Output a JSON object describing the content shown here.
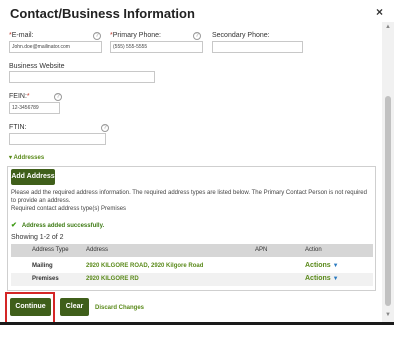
{
  "dialog": {
    "title": "Contact/Business Information",
    "close_glyph": "×"
  },
  "form": {
    "email": {
      "label": "E-mail:",
      "value": "John.doe@mailinator.com"
    },
    "primary_phone": {
      "label": "Primary Phone:",
      "value": "(555) 555-5555"
    },
    "secondary_phone": {
      "label": "Secondary Phone:",
      "value": ""
    },
    "website": {
      "label": "Business Website",
      "value": ""
    },
    "fein": {
      "label": "FEIN:",
      "value": "12-3456789"
    },
    "ftin": {
      "label": "FTIN:",
      "value": ""
    },
    "required_mark": "*",
    "help_glyph": "?"
  },
  "addresses": {
    "toggle_label": "Addresses",
    "add_button": "Add Address",
    "info_text": "Please add the required address information. The required address types are listed below. The Primary Contact Person is not required to provide an address.",
    "required_text": "Required contact address type(s) Premises",
    "success_text": "Address added successfully.",
    "showing_text": "Showing 1-2 of 2",
    "columns": [
      "Address Type",
      "Address",
      "APN",
      "Action"
    ],
    "rows": [
      {
        "type": "Mailing",
        "address": "2920 KILGORE ROAD, 2920 Kilgore Road",
        "apn": "",
        "action": "Actions"
      },
      {
        "type": "Premises",
        "address": "2920 KILGORE RD",
        "apn": "",
        "action": "Actions"
      }
    ]
  },
  "footer": {
    "continue": "Continue",
    "clear": "Clear",
    "discard": "Discard Changes"
  },
  "colors": {
    "accent_green": "#3f5f1a",
    "link_green": "#5a8a1a",
    "highlight_red": "#d42626"
  }
}
